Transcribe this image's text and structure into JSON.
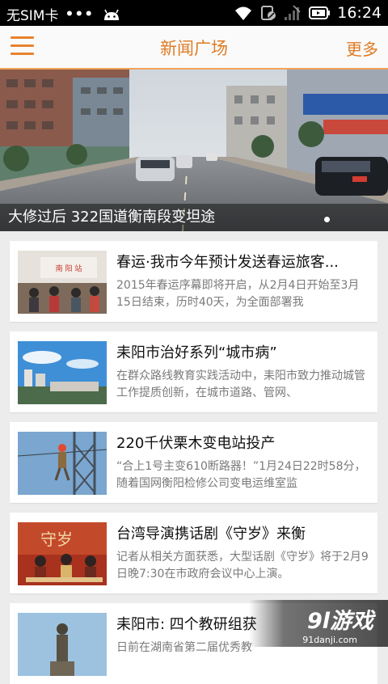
{
  "status_bar": {
    "carrier": "无SIM卡",
    "dots": "•••",
    "time": "16:24",
    "icons": [
      "android-icon",
      "wifi-icon",
      "no-sim-icon",
      "signal-icon",
      "battery-icon"
    ]
  },
  "header": {
    "title": "新闻广场",
    "more_label": "更多",
    "menu_icon": "hamburger-menu-icon",
    "accent_color": "#e07b24"
  },
  "hero": {
    "caption": "大修过后 322国道衡南段变坦途"
  },
  "news": [
    {
      "headline": "春运·我市今年预计发送春运旅客...",
      "summary": "2015年春运序幕即将开启，从2月4日开始至3月15日结束，历时40天，为全面部署我"
    },
    {
      "headline": "耒阳市治好系列“城市病”",
      "summary": "在群众路线教育实践活动中，耒阳市致力推动城管工作提质创新，在城市道路、管网、"
    },
    {
      "headline": "220千伏栗木变电站投产",
      "summary": "“合上1号主变610断路器！”1月24日22时58分，随着国网衡阳检修公司变电运维室监"
    },
    {
      "headline": "台湾导演携话剧《守岁》来衡",
      "summary": "记者从相关方面获悉，大型话剧《守岁》将于2月9日晚7:30在市政府会议中心上演。"
    },
    {
      "headline": "耒阳市: 四个教研组获",
      "summary": "日前在湖南省第二届优秀教"
    }
  ],
  "thumb_text": {
    "station_sign": "南 阳 站",
    "poster_text": "守岁"
  },
  "watermark": {
    "brand": "9l游戏",
    "site": "91danji.com"
  }
}
